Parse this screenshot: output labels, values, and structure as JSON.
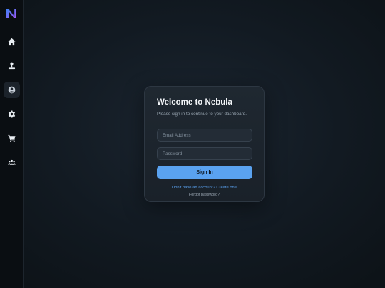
{
  "sidebar": {
    "logo": "nebula-logo",
    "items": [
      {
        "icon": "home-icon"
      },
      {
        "icon": "user-icon"
      },
      {
        "icon": "profile-icon",
        "active": true
      },
      {
        "icon": "gear-icon"
      },
      {
        "icon": "cart-icon"
      },
      {
        "icon": "users-icon"
      }
    ]
  },
  "login": {
    "title": "Welcome to Nebula",
    "subtitle": "Please sign in to continue to your dashboard.",
    "email_placeholder": "Email Address",
    "email_value": "",
    "password_placeholder": "Password",
    "password_value": "",
    "signin_label": "Sign In",
    "signup_text": "Don't have an account? Create one",
    "forgot_text": "Forgot password?"
  },
  "colors": {
    "accent": "#5aa2f0",
    "sidebar_bg": "#0a0e12",
    "card_bg": "#1c242c",
    "logo_gradient": [
      "#3b82f6",
      "#a855f7"
    ]
  }
}
